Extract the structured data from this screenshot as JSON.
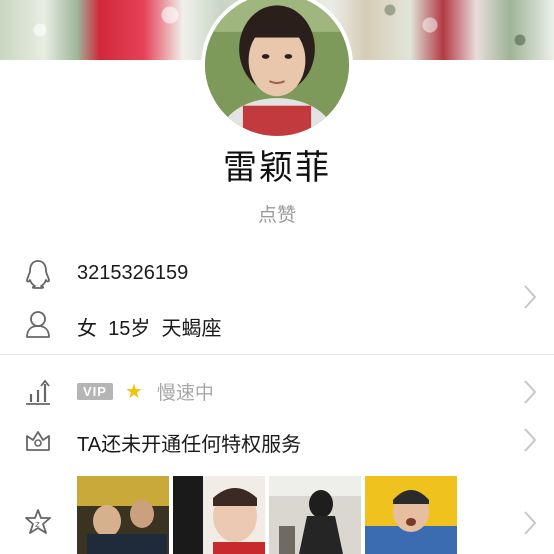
{
  "profile": {
    "name": "雷颖菲",
    "like_label": "点赞"
  },
  "info": {
    "qq_number": "3215326159",
    "details": "女  15岁  天蝎座"
  },
  "privilege": {
    "vip_label": "VIP",
    "speed_status": "慢速中",
    "service_text": "TA还未开通任何特权服务"
  },
  "icons": {
    "qq": "qq-penguin-icon",
    "person": "person-icon",
    "level": "level-bars-icon",
    "crown": "crown-icon",
    "star": "star-icon",
    "photos": "photo-wall-icon",
    "chevron": "chevron-right-icon"
  },
  "colors": {
    "vip_badge": "#b5b5b5",
    "star": "#f4c20d",
    "muted_text": "#9b9b9b",
    "chevron": "#c7c7c7"
  }
}
